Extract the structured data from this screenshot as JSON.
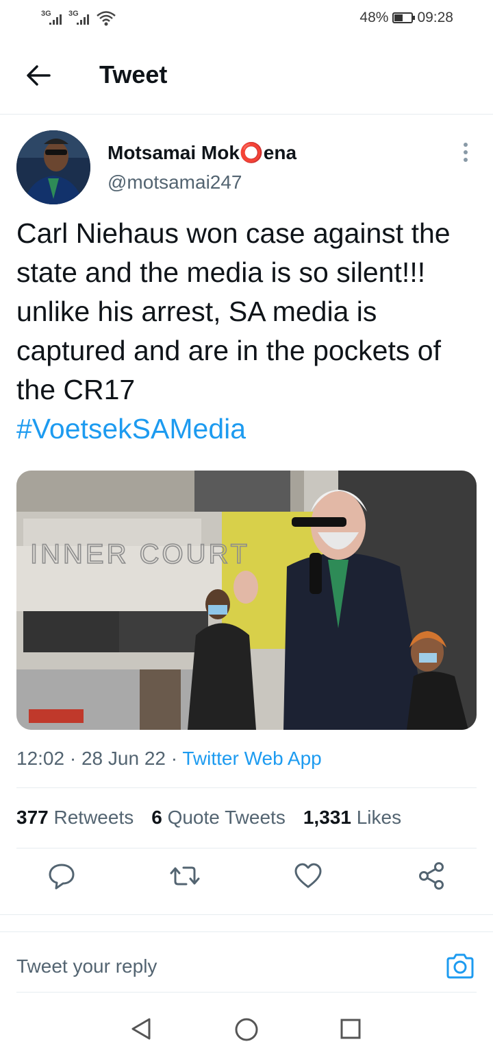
{
  "status_bar": {
    "signal1": "3G",
    "signal2": "3G",
    "battery": "48%",
    "battery_level": 0.48,
    "time": "09:28"
  },
  "header": {
    "title": "Tweet"
  },
  "tweet": {
    "author_name": "Motsamai Mok⭕ena",
    "author_handle": "@motsamai247",
    "text": "Carl Niehaus won case against the state and the media is so silent!!! unlike his arrest, SA media is captured and are in the pockets of the CR17",
    "hashtag": "#VoetsekSAMedia",
    "photo_sign": "INNER COURT",
    "time": "12:02",
    "date": "28 Jun 22",
    "source": "Twitter Web App",
    "stats": [
      {
        "count": "377",
        "label": "Retweets"
      },
      {
        "count": "6",
        "label": "Quote Tweets"
      },
      {
        "count": "1,331",
        "label": "Likes"
      }
    ]
  },
  "reply": {
    "placeholder": "Tweet your reply"
  },
  "icons": {
    "back": "back-arrow-icon",
    "more": "more-vertical-icon",
    "reply": "reply-icon",
    "retweet": "retweet-icon",
    "like": "heart-icon",
    "share": "share-icon",
    "camera": "camera-icon"
  },
  "colors": {
    "accent": "#1d9bf0",
    "text": "#0f1419",
    "secondary": "#536471"
  }
}
